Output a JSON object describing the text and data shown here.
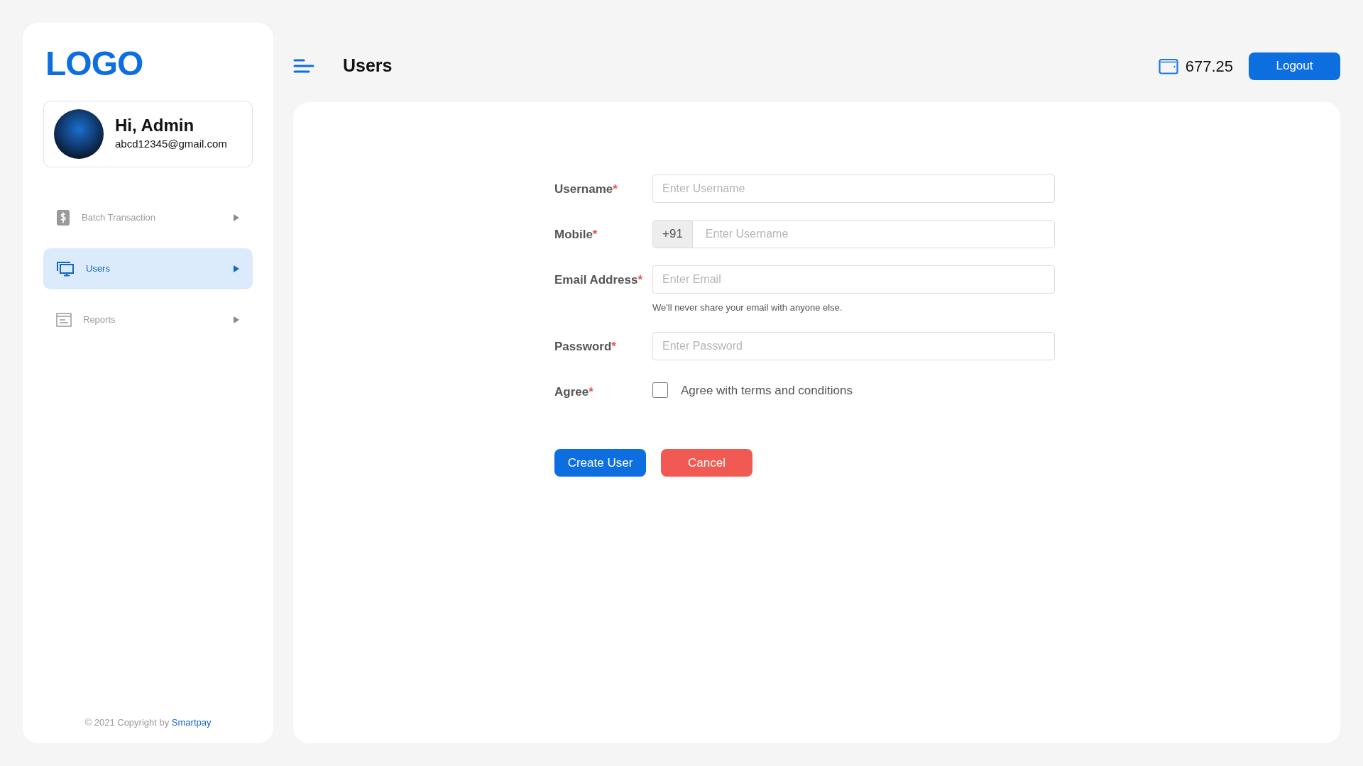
{
  "sidebar": {
    "logo": "LOGO",
    "profile": {
      "greeting": "Hi, Admin",
      "email": "abcd12345@gmail.com"
    },
    "nav": [
      {
        "label": "Batch Transaction",
        "kind": "dollar",
        "selected": false
      },
      {
        "label": "Users",
        "kind": "monitor",
        "selected": true
      },
      {
        "label": "Reports",
        "kind": "report",
        "selected": false
      }
    ],
    "footer": {
      "text": "© 2021 Copyright by ",
      "link": "Smartpay"
    }
  },
  "header": {
    "title": "Users",
    "balance": "677.25",
    "logout": "Logout"
  },
  "form": {
    "fields": [
      {
        "kind": "text",
        "label": "Username",
        "required_mark": "*",
        "placeholder": "Enter Username"
      },
      {
        "kind": "prefixed",
        "label": "Mobile",
        "required_mark": "*",
        "prefix": "+91",
        "placeholder": "Enter Username"
      },
      {
        "kind": "email",
        "label": "Email Address",
        "required_mark": "*",
        "placeholder": "Enter Email",
        "hint": "We'll never share your email with anyone else."
      },
      {
        "kind": "password",
        "label": "Password",
        "required_mark": "*",
        "placeholder": "Enter Password"
      },
      {
        "kind": "checkbox",
        "label": "Agree",
        "required_mark": "*",
        "text": "Agree with terms and conditions",
        "checked": false
      }
    ],
    "buttons": [
      {
        "label": "Create User",
        "kind": "primary"
      },
      {
        "label": "Cancel",
        "kind": "danger"
      }
    ]
  }
}
